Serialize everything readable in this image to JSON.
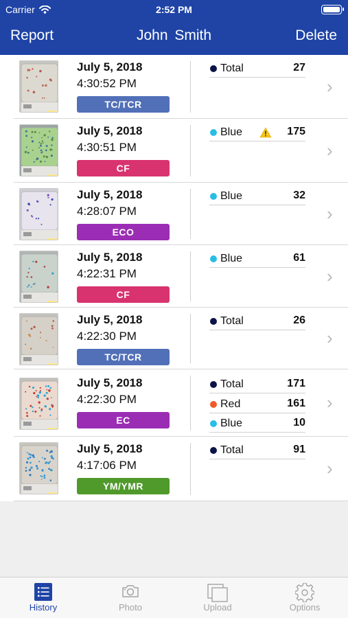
{
  "status_bar": {
    "carrier": "Carrier",
    "time": "2:52 PM"
  },
  "nav": {
    "left_button": "Report",
    "title": "John  Smith",
    "right_button": "Delete"
  },
  "records": [
    {
      "date": "July 5, 2018",
      "time": "4:30:52 PM",
      "type": "TC/TCR",
      "type_color": "#5270b8",
      "counts": [
        {
          "label": "Total",
          "value": "27",
          "color": "#0c1347",
          "warning": false
        }
      ]
    },
    {
      "date": "July 5, 2018",
      "time": "4:30:51 PM",
      "type": "CF",
      "type_color": "#d8336e",
      "counts": [
        {
          "label": "Blue",
          "value": "175",
          "color": "#29bde6",
          "warning": true
        }
      ]
    },
    {
      "date": "July 5, 2018",
      "time": "4:28:07 PM",
      "type": "ECO",
      "type_color": "#9b2db4",
      "counts": [
        {
          "label": "Blue",
          "value": "32",
          "color": "#29bde6",
          "warning": false
        }
      ]
    },
    {
      "date": "July 5, 2018",
      "time": "4:22:31 PM",
      "type": "CF",
      "type_color": "#d8336e",
      "counts": [
        {
          "label": "Blue",
          "value": "61",
          "color": "#29bde6",
          "warning": false
        }
      ]
    },
    {
      "date": "July 5, 2018",
      "time": "4:22:30 PM",
      "type": "TC/TCR",
      "type_color": "#5270b8",
      "counts": [
        {
          "label": "Total",
          "value": "26",
          "color": "#0c1347",
          "warning": false
        }
      ]
    },
    {
      "date": "July 5, 2018",
      "time": "4:22:30 PM",
      "type": "EC",
      "type_color": "#9b2db4",
      "counts": [
        {
          "label": "Total",
          "value": "171",
          "color": "#0c1347",
          "warning": false
        },
        {
          "label": "Red",
          "value": "161",
          "color": "#f05a2a",
          "warning": false
        },
        {
          "label": "Blue",
          "value": "10",
          "color": "#29bde6",
          "warning": false
        }
      ]
    },
    {
      "date": "July 5, 2018",
      "time": "4:17:06 PM",
      "type": "YM/YMR",
      "type_color": "#4f9a2b",
      "counts": [
        {
          "label": "Total",
          "value": "91",
          "color": "#0c1347",
          "warning": false
        }
      ]
    }
  ],
  "tab_bar": [
    {
      "label": "History",
      "icon": "list-icon",
      "active": true
    },
    {
      "label": "Photo",
      "icon": "camera-icon",
      "active": false
    },
    {
      "label": "Upload",
      "icon": "upload-icon",
      "active": false
    },
    {
      "label": "Options",
      "icon": "gear-icon",
      "active": false
    }
  ],
  "colors": {
    "brand": "#1f44a6",
    "warning": "#f5c518"
  }
}
